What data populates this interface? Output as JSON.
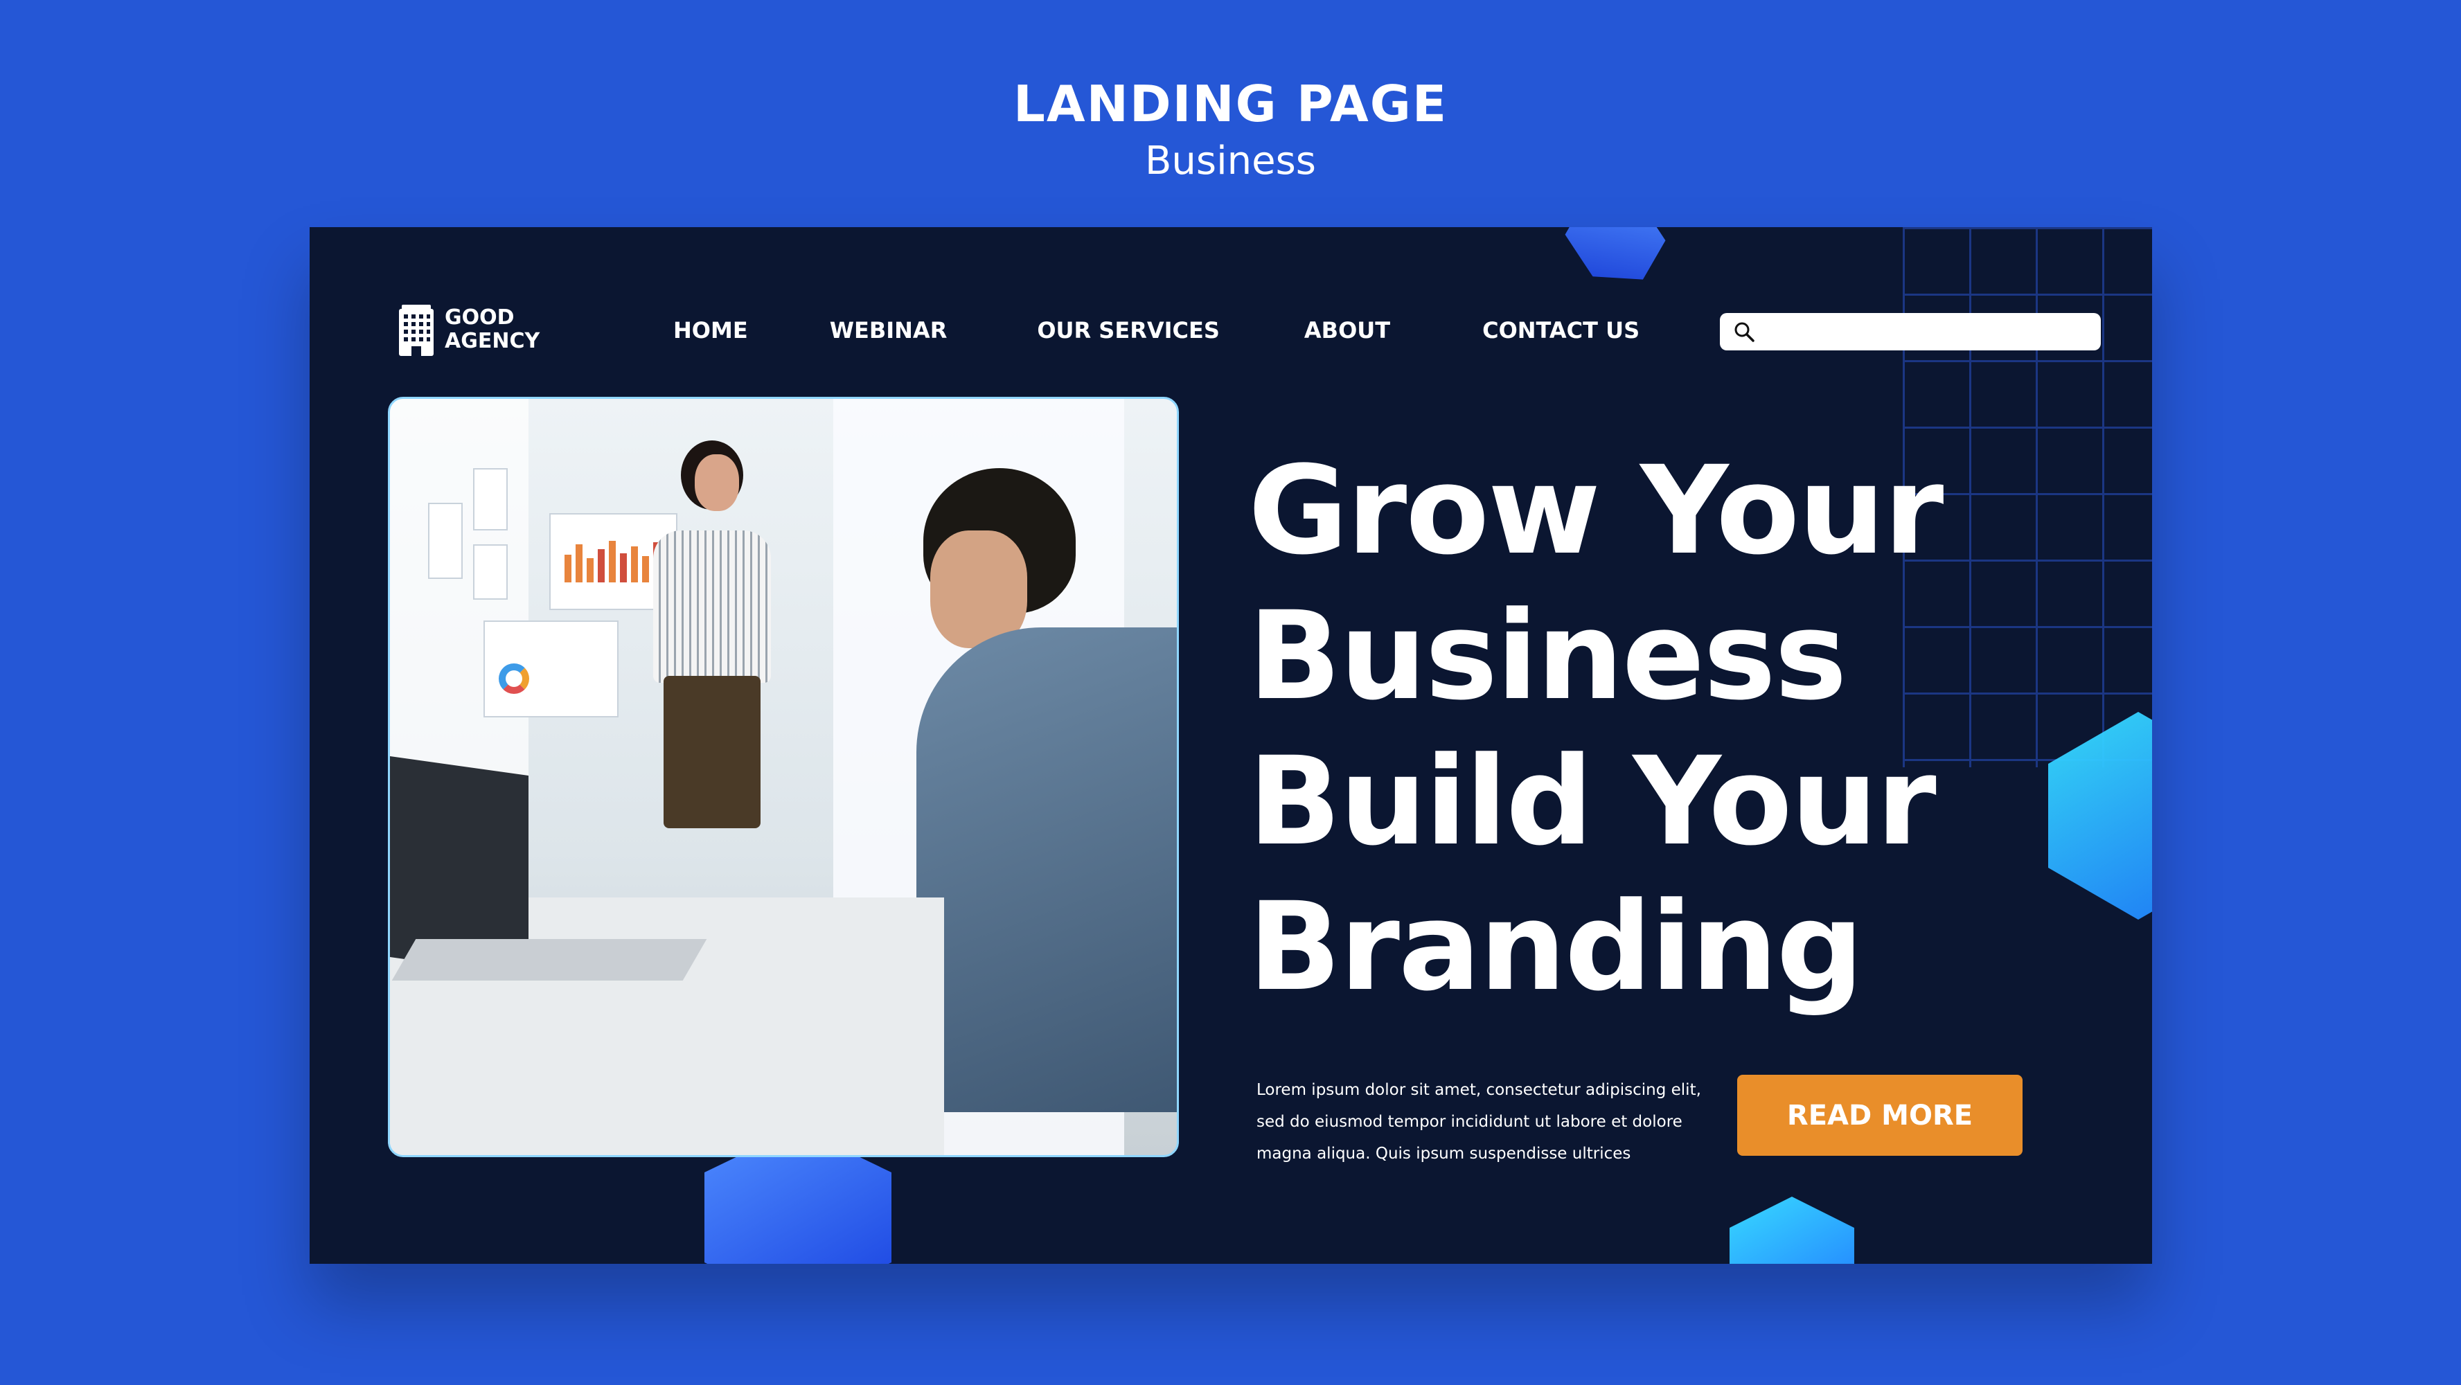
{
  "outer": {
    "title": "LANDING PAGE",
    "subtitle": "Business"
  },
  "brand": {
    "line1": "GOOD",
    "line2": "AGENCY",
    "icon": "building-icon"
  },
  "nav": {
    "items": [
      {
        "label": "HOME"
      },
      {
        "label": "WEBINAR"
      },
      {
        "label": "OUR SERVICES"
      },
      {
        "label": "ABOUT"
      },
      {
        "label": "CONTACT US"
      }
    ]
  },
  "search": {
    "placeholder": "",
    "value": "",
    "icon": "search-icon"
  },
  "hero": {
    "headline_lines": [
      "Grow Your",
      "Business",
      "Build Your",
      "Branding"
    ],
    "body_lines": [
      "Lorem ipsum dolor sit amet, consectetur adipiscing elit,",
      "sed do eiusmod tempor incididunt ut labore et dolore",
      "magna aliqua. Quis ipsum suspendisse ultrices"
    ],
    "cta_label": "READ MORE"
  },
  "colors": {
    "page_bg": "#2557d6",
    "panel_bg": "#0b1631",
    "accent_orange": "#e98e2a",
    "accent_cyan": "#37e1ff",
    "text": "#ffffff"
  }
}
